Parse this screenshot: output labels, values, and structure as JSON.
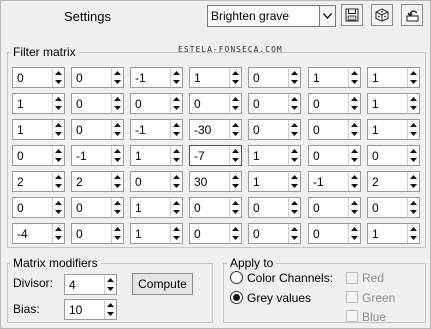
{
  "header": {
    "settings_label": "Settings",
    "preset_value": "Brighten grave",
    "save_icon": "floppy-disk-icon",
    "random_icon": "dice-icon",
    "reset_icon": "reset-arrow-icon"
  },
  "filter_matrix": {
    "title": "Filter matrix",
    "watermark": "ESTELA-FONSECA.COM",
    "rows": [
      [
        "0",
        "0",
        "-1",
        "1",
        "0",
        "1",
        "1"
      ],
      [
        "1",
        "0",
        "0",
        "0",
        "0",
        "0",
        "1"
      ],
      [
        "1",
        "0",
        "-1",
        "-30",
        "0",
        "0",
        "1"
      ],
      [
        "0",
        "-1",
        "1",
        "-7",
        "1",
        "0",
        "0"
      ],
      [
        "2",
        "2",
        "0",
        "30",
        "1",
        "-1",
        "2"
      ],
      [
        "0",
        "0",
        "1",
        "0",
        "0",
        "0",
        "0"
      ],
      [
        "-4",
        "0",
        "1",
        "0",
        "0",
        "0",
        "1"
      ]
    ]
  },
  "matrix_modifiers": {
    "title": "Matrix modifiers",
    "divisor_label": "Divisor:",
    "divisor_value": "4",
    "bias_label": "Bias:",
    "bias_value": "10",
    "compute_label": "Compute"
  },
  "apply_to": {
    "title": "Apply to",
    "color_channels_label": "Color Channels:",
    "grey_values_label": "Grey values",
    "selected": "grey_values",
    "red_label": "Red",
    "green_label": "Green",
    "blue_label": "Blue"
  }
}
